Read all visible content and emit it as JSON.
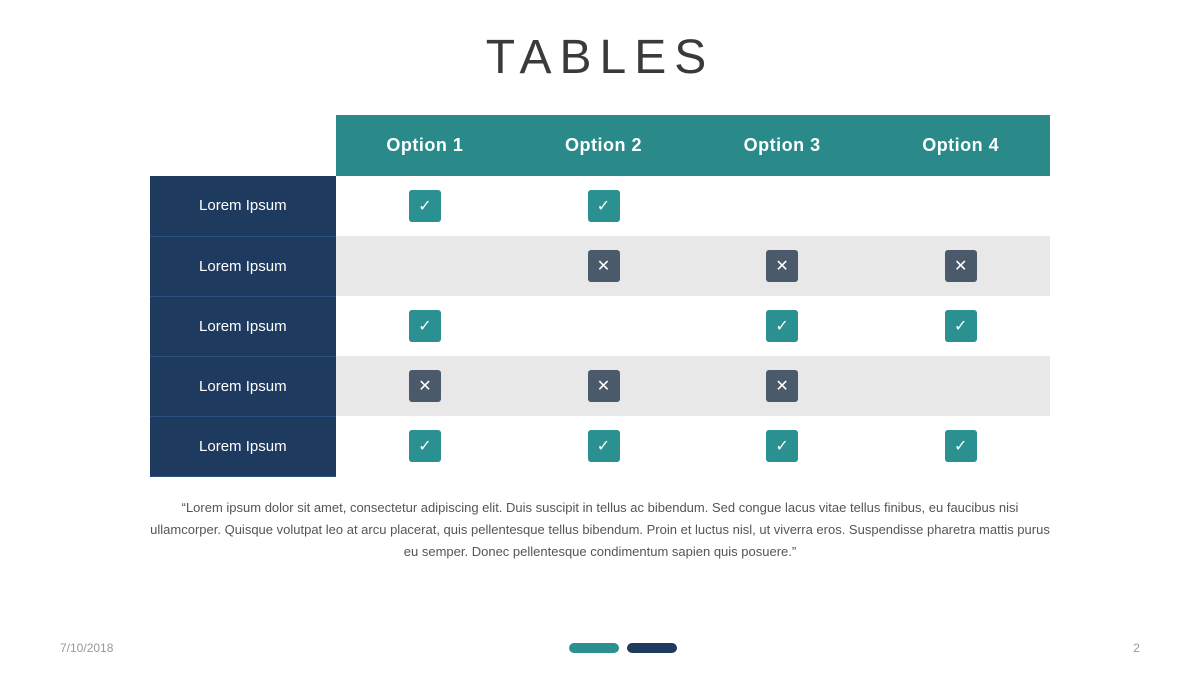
{
  "slide": {
    "title": "TABLES",
    "table": {
      "header": {
        "empty": "",
        "col1": "Option 1",
        "col2": "Option 2",
        "col3": "Option 3",
        "col4": "Option 4"
      },
      "rows": [
        {
          "label": "Lorem Ipsum",
          "col1": "check",
          "col2": "check",
          "col3": "",
          "col4": ""
        },
        {
          "label": "Lorem Ipsum",
          "col1": "",
          "col2": "x",
          "col3": "x",
          "col4": "x"
        },
        {
          "label": "Lorem Ipsum",
          "col1": "check",
          "col2": "",
          "col3": "check",
          "col4": "check"
        },
        {
          "label": "Lorem Ipsum",
          "col1": "x",
          "col2": "x",
          "col3": "x",
          "col4": ""
        },
        {
          "label": "Lorem Ipsum",
          "col1": "check",
          "col2": "check",
          "col3": "check",
          "col4": "check"
        }
      ]
    },
    "quote": "“Lorem ipsum dolor sit amet, consectetur adipiscing elit. Duis suscipit in tellus ac bibendum. Sed congue lacus vitae tellus finibus, eu faucibus nisi ullamcorper. Quisque volutpat leo at arcu placerat,  quis pellentesque tellus bibendum. Proin et luctus nisl, ut viverra eros. Suspendisse pharetra mattis purus eu semper. Donec pellentesque condimentum sapien quis posuere.”",
    "footer": {
      "date": "7/10/2018",
      "page": "2"
    }
  }
}
